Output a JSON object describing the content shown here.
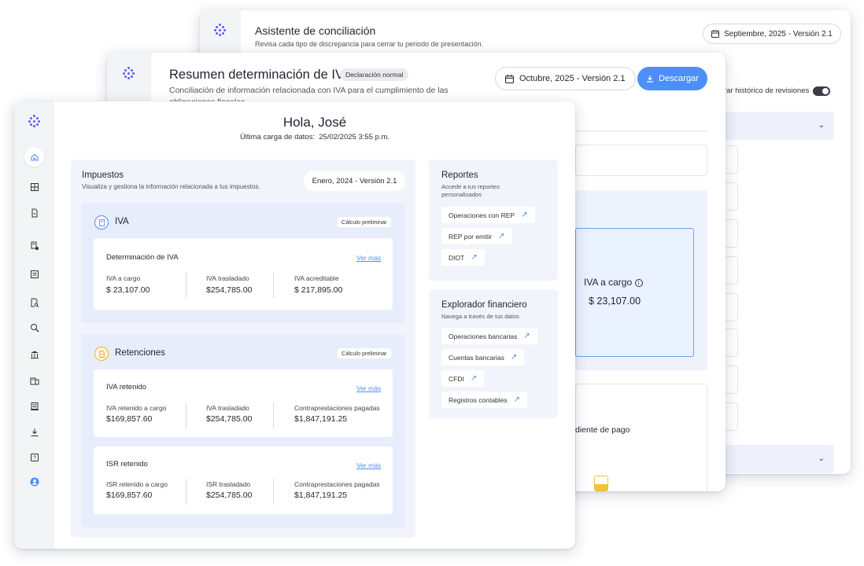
{
  "colors": {
    "accent": "#4d8ff8",
    "brand": "#5b5ff0",
    "panel": "#f2f4fb",
    "warning": "#f5c232"
  },
  "back_window": {
    "title": "Asistente de conciliación",
    "subtitle": "Revisa cada tipo de discrepancia para cerrar tu periodo de presentación.",
    "period": "Septiembre, 2025 - Versión 2.1",
    "toggle_label": "rar histórico de revisiones",
    "toggle_on": true
  },
  "middle_window": {
    "title": "Resumen determinación de IVA",
    "badge": "Declaración normal",
    "subtitle": "Conciliación de información relacionada con IVA para el cumplimiento de las obligaciones fiscales",
    "period": "Octubre, 2025 - Versión 2.1",
    "download_label": "Descargar",
    "card_label": "IVA a cargo",
    "card_value": "$ 23,107.00",
    "lower_text": "diente de pago",
    "bar_fill_percent": 45
  },
  "front_window": {
    "greeting": "Hola, José",
    "last_upload_label": "Última carga de datos:",
    "last_upload_value": "25/02/2025 3:55 p.m.",
    "nav_icons": [
      "home-icon",
      "dashboard-icon",
      "document-icon",
      "invoice-check-icon",
      "list-icon",
      "file-search-icon",
      "zoom-icon",
      "bank-icon",
      "buildings-icon",
      "receipt-icon",
      "download-icon",
      "help-icon",
      "user-icon"
    ],
    "taxes": {
      "title": "Impuestos",
      "subtitle": "Visualiza y gestiona la información relacionada a tus impuestos.",
      "period": "Enero, 2024 - Versión 2.1",
      "iva": {
        "title": "IVA",
        "tag": "Cálculo preliminar",
        "card_title": "Determinación de IVA",
        "link": "Ver más",
        "items": [
          {
            "label": "IVA a cargo",
            "value": "$ 23,107.00"
          },
          {
            "label": "IVA trasladado",
            "value": "$254,785.00"
          },
          {
            "label": "IVA acreditable",
            "value": "$ 217,895.00"
          }
        ]
      },
      "retenciones": {
        "title": "Retenciones",
        "tag": "Cálculo preliminar",
        "cards": [
          {
            "title": "IVA retenido",
            "link": "Ver más",
            "items": [
              {
                "label": "IVA retenido a cargo",
                "value": "$169,857.60"
              },
              {
                "label": "IVA trasladado",
                "value": "$254,785.00"
              },
              {
                "label": "Contraprestaciones pagadas",
                "value": "$1,847,191.25"
              }
            ]
          },
          {
            "title": "ISR retenido",
            "link": "Ver más",
            "items": [
              {
                "label": "ISR retenido a cargo",
                "value": "$169,857.60"
              },
              {
                "label": "ISR trasladado",
                "value": "$254,785.00"
              },
              {
                "label": "Contraprestaciones pagadas",
                "value": "$1,847,191.25"
              }
            ]
          }
        ]
      }
    },
    "reports": {
      "title": "Reportes",
      "subtitle": "Accede a tus reportes personalizados",
      "links": [
        "Operaciones con REP",
        "REP por emitir",
        "DIOT"
      ]
    },
    "explorer": {
      "title": "Explorador financiero",
      "subtitle": "Navega a través de tus datos",
      "links": [
        "Operaciones bancarias",
        "Cuentas bancarias",
        "CFDI",
        "Registros contables"
      ]
    }
  }
}
